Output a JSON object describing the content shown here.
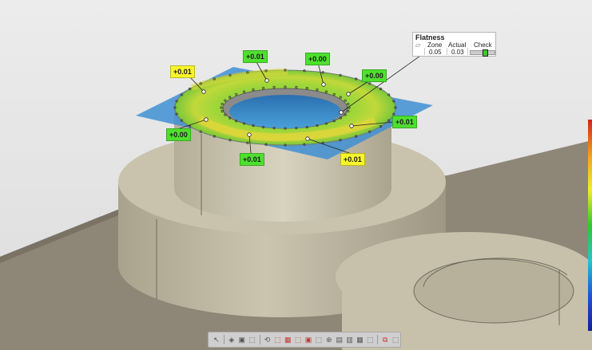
{
  "fcf": {
    "title": "Flatness",
    "symbol": "▱",
    "headers": {
      "zone": "Zone",
      "actual": "Actual",
      "check": "Check"
    },
    "zone": "0.05",
    "actual": "0.03",
    "check_fraction": 0.6
  },
  "deviation_labels": [
    {
      "text": "+0.01",
      "color": "yellow"
    },
    {
      "text": "+0.01",
      "color": "green"
    },
    {
      "text": "+0.00",
      "color": "green"
    },
    {
      "text": "+0.00",
      "color": "green"
    },
    {
      "text": "+0.01",
      "color": "green"
    },
    {
      "text": "+0.00",
      "color": "green"
    },
    {
      "text": "+0.01",
      "color": "green"
    },
    {
      "text": "+0.01",
      "color": "yellow"
    }
  ],
  "colors": {
    "plane": "#3f8fd4",
    "part": "#c3bda6",
    "floor": "#8e8677",
    "label_green": "#4ee02e",
    "label_yellow": "#f7f52a"
  },
  "toolbar": {
    "buttons": [
      "↖",
      "◈",
      "▣",
      "⬚",
      "⟲",
      "⬚",
      "▦",
      "⬚",
      "▣",
      "⬚",
      "⊕",
      "▤",
      "▥",
      "▦",
      "⬚",
      "⧉",
      "⬚"
    ]
  }
}
